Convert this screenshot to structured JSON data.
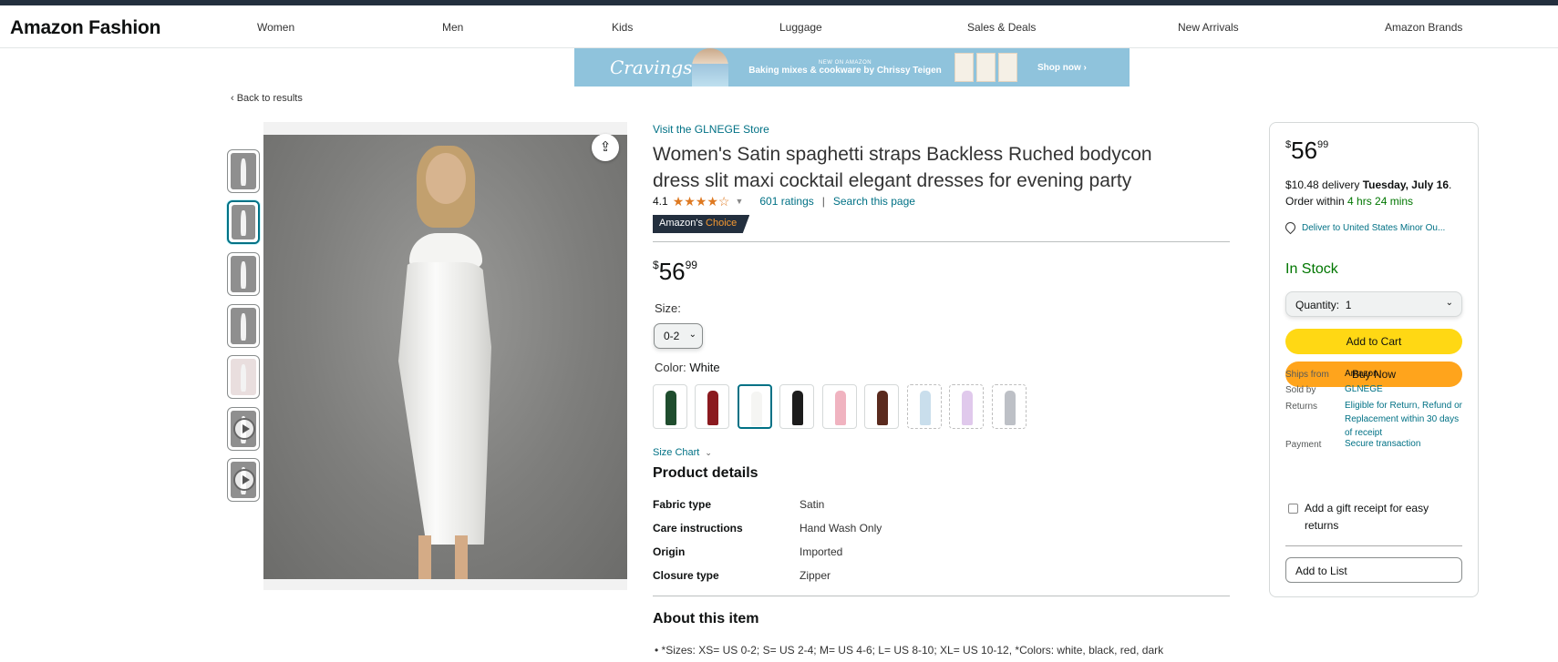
{
  "header": {
    "brand": "Amazon Fashion",
    "nav": [
      "Women",
      "Men",
      "Kids",
      "Luggage",
      "Sales & Deals",
      "New Arrivals",
      "Amazon Brands"
    ]
  },
  "banner": {
    "logo": "Cravings",
    "eyebrow": "NEW ON AMAZON",
    "headline": "Baking mixes & cookware by Chrissy Teigen",
    "cta": "Shop now ›"
  },
  "back_link": "‹ Back to results",
  "product": {
    "store_link": "Visit the GLNEGE Store",
    "title": "Women's Satin spaghetti straps Backless Ruched bodycon dress slit maxi cocktail elegant dresses for evening party",
    "rating": "4.1",
    "stars": "★★★★☆",
    "ratings_count": "601 ratings",
    "search_page": "Search this page",
    "badge_prefix": "Amazon's",
    "badge_choice": "Choice",
    "price_symbol": "$",
    "price_whole": "56",
    "price_fraction": "99",
    "size_label": "Size:",
    "size_value": "0-2",
    "color_label": "Color:",
    "color_value": "White",
    "swatch_colors": [
      "#1f4d2e",
      "#8b1a1f",
      "#f5f5f3",
      "#1c1c1c",
      "#f0b3c0",
      "#5a2a1e",
      "#b8d3e6",
      "#d6b8e6",
      "#a8acb3"
    ],
    "size_chart": "Size Chart",
    "details_heading": "Product details",
    "details": [
      {
        "key": "Fabric type",
        "value": "Satin"
      },
      {
        "key": "Care instructions",
        "value": "Hand Wash Only"
      },
      {
        "key": "Origin",
        "value": "Imported"
      },
      {
        "key": "Closure type",
        "value": "Zipper"
      }
    ],
    "about_heading": "About this item",
    "about_first": "*Sizes: XS= US 0-2; S= US 2-4; M= US 4-6; L= US 8-10; XL= US 10-12, *Colors: white, black, red, dark"
  },
  "buybox": {
    "price_symbol": "$",
    "price_whole": "56",
    "price_fraction": "99",
    "delivery_fee": "$10.48 delivery",
    "delivery_date": "Tuesday, July 16",
    "order_within_label": "Order within",
    "order_within": "4 hrs 24 mins",
    "deliver_to": "Deliver to United States Minor Ou...",
    "stock": "In Stock",
    "quantity_label": "Quantity:",
    "quantity_value": "1",
    "add_to_cart": "Add to Cart",
    "buy_now": "Buy Now",
    "ships_from_label": "Ships from",
    "ships_from": "Amazon",
    "sold_by_label": "Sold by",
    "sold_by": "GLNEGE",
    "returns_label": "Returns",
    "returns": "Eligible for Return, Refund or Replacement within 30 days of receipt",
    "payment_label": "Payment",
    "payment": "Secure transaction",
    "gift_receipt": "Add a gift receipt for easy returns",
    "add_to_list": "Add to List"
  },
  "colors": {
    "link": "#007185",
    "stock_green": "#007600",
    "add_to_cart": "#ffd814",
    "buy_now": "#ffa41c",
    "star": "#de7921"
  }
}
